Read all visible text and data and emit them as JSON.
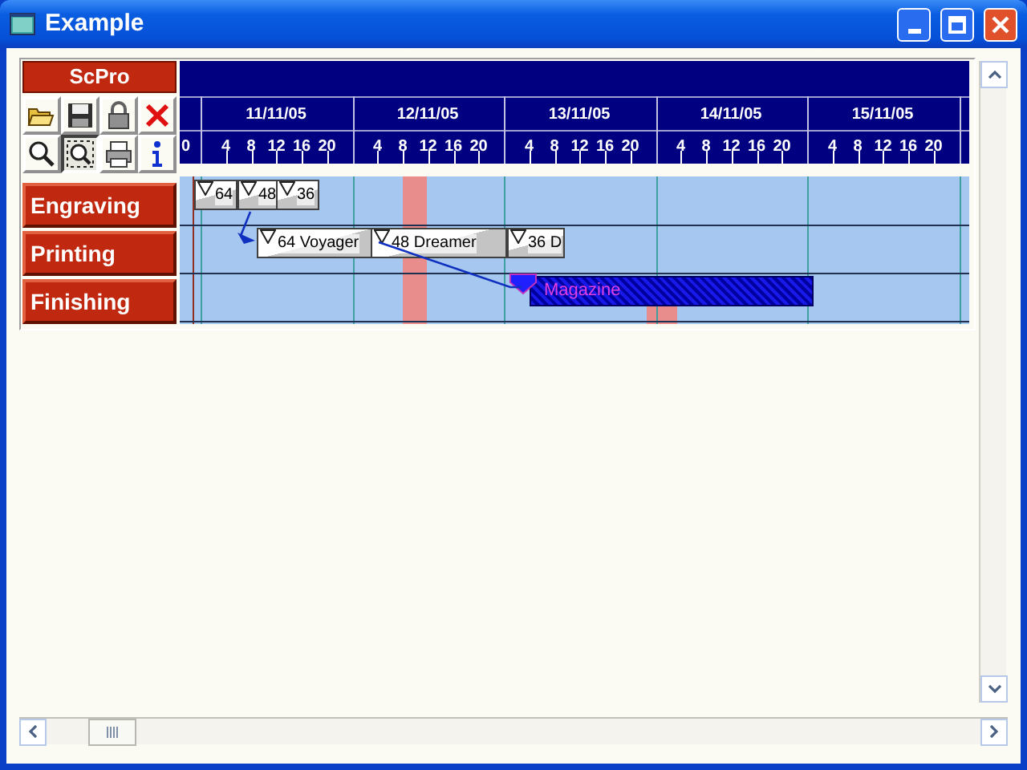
{
  "window": {
    "title": "Example"
  },
  "header": "ScPro",
  "toolbar": [
    {
      "kind": "open",
      "selected": false
    },
    {
      "kind": "save",
      "selected": false
    },
    {
      "kind": "lock",
      "selected": false
    },
    {
      "kind": "delete",
      "selected": false
    },
    {
      "kind": "zoom",
      "selected": false
    },
    {
      "kind": "zoom-area",
      "selected": true
    },
    {
      "kind": "print",
      "selected": false
    },
    {
      "kind": "info",
      "selected": false
    }
  ],
  "timeline": {
    "lead_hour": "0",
    "days": [
      {
        "date": "11/11/05",
        "hours": [
          "4",
          "8",
          "12",
          "16",
          "20"
        ]
      },
      {
        "date": "12/11/05",
        "hours": [
          "4",
          "8",
          "12",
          "16",
          "20"
        ]
      },
      {
        "date": "13/11/05",
        "hours": [
          "4",
          "8",
          "12",
          "16",
          "20"
        ]
      },
      {
        "date": "14/11/05",
        "hours": [
          "4",
          "8",
          "12",
          "16",
          "20"
        ]
      },
      {
        "date": "15/11/05",
        "hours": [
          "4",
          "8",
          "12",
          "16",
          "20"
        ]
      }
    ]
  },
  "resources": [
    {
      "name": "Engraving",
      "tasks": [
        {
          "label": "64",
          "kind": "batch"
        },
        {
          "label": "48",
          "kind": "batch"
        },
        {
          "label": "36",
          "kind": "batch"
        }
      ]
    },
    {
      "name": "Printing",
      "tasks": [
        {
          "label": "64 Voyager",
          "kind": "batch"
        },
        {
          "label": "48 Dreamer",
          "kind": "batch"
        },
        {
          "label": "36 D",
          "kind": "batch"
        }
      ]
    },
    {
      "name": "Finishing",
      "tasks": [
        {
          "label": "Magazine",
          "kind": "selected"
        }
      ]
    }
  ]
}
